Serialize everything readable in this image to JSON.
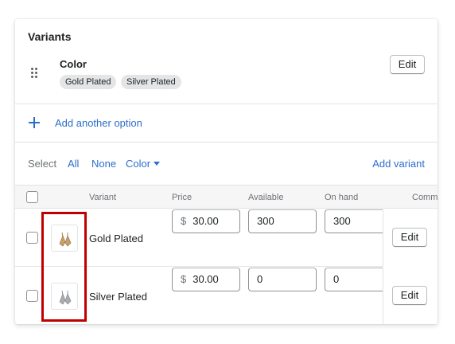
{
  "card": {
    "title": "Variants"
  },
  "option": {
    "name": "Color",
    "values": [
      "Gold Plated",
      "Silver Plated"
    ],
    "edit_label": "Edit"
  },
  "add_option": {
    "label": "Add another option"
  },
  "select_bar": {
    "label": "Select",
    "all": "All",
    "none": "None",
    "color": "Color",
    "add_variant": "Add variant"
  },
  "table": {
    "headers": [
      "Variant",
      "Price",
      "Available",
      "On hand",
      "Comm"
    ],
    "rows": [
      {
        "variant": "Gold Plated",
        "currency": "$",
        "price": "30.00",
        "available": "300",
        "on_hand": "300",
        "edit_label": "Edit",
        "thumb_color": "#c8a16a"
      },
      {
        "variant": "Silver Plated",
        "currency": "$",
        "price": "30.00",
        "available": "0",
        "on_hand": "0",
        "edit_label": "Edit",
        "thumb_color": "#a9adb2"
      }
    ]
  },
  "colors": {
    "link": "#2c6ecb",
    "highlight": "#c00000",
    "tag_bg": "#e4e5e7"
  }
}
